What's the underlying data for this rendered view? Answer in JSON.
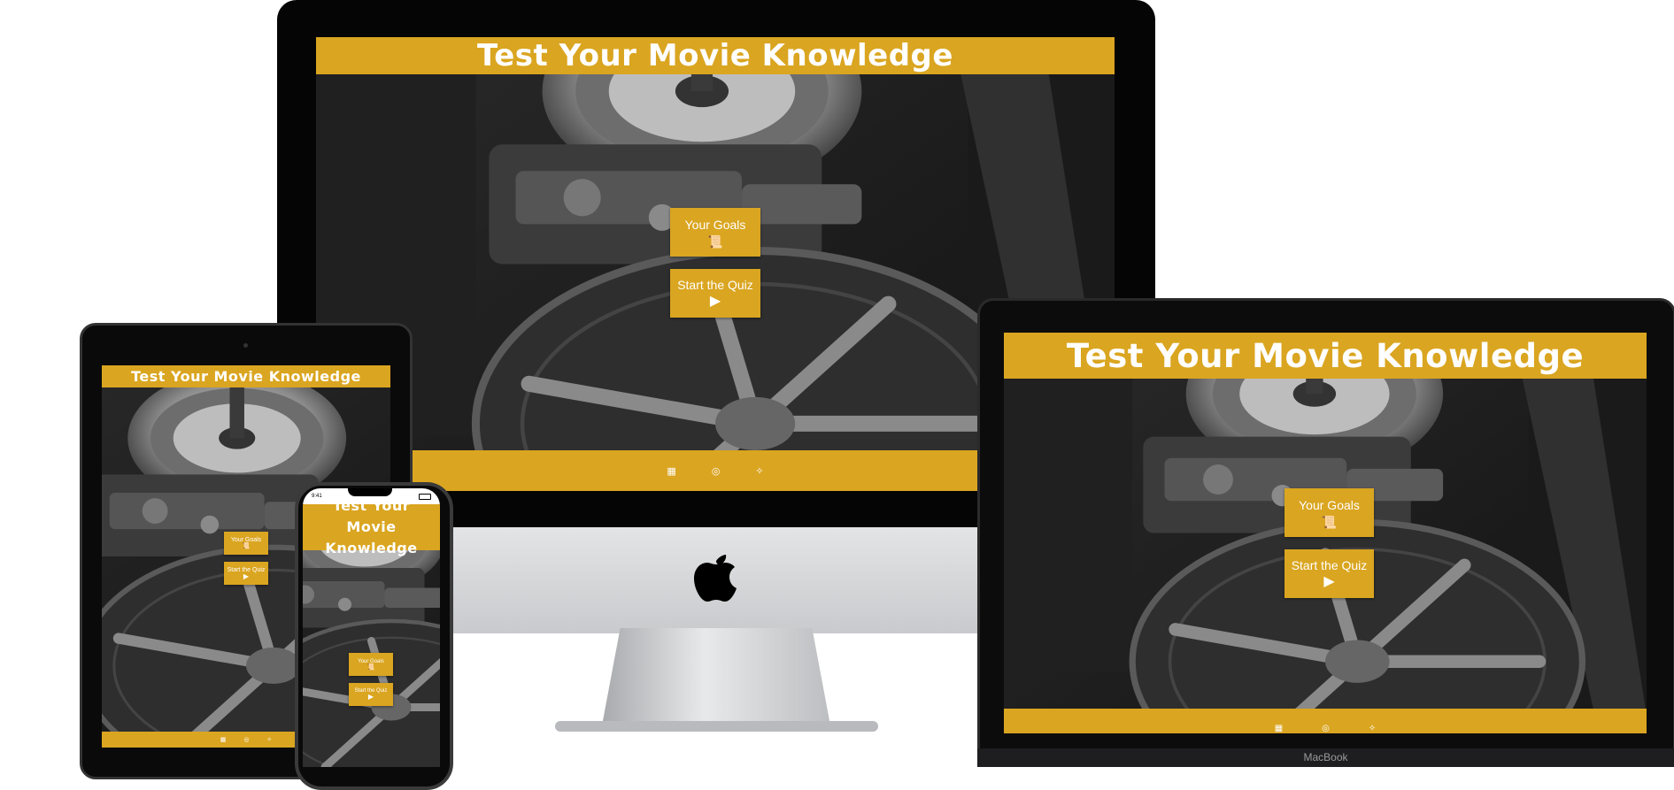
{
  "site": {
    "title": "Test Your Movie Knowledge",
    "goals_label": "Your Goals",
    "quiz_label": "Start the Quiz"
  },
  "icons": {
    "goals": "scroll-icon",
    "quiz": "play-icon",
    "social": [
      "facebook-icon",
      "instagram-icon",
      "twitter-icon"
    ]
  },
  "devices": {
    "laptop_label": "MacBook",
    "phone_time": "9:41"
  },
  "colors": {
    "accent": "#daa520",
    "text": "#ffffff",
    "backdrop": "#1b1b1b"
  }
}
